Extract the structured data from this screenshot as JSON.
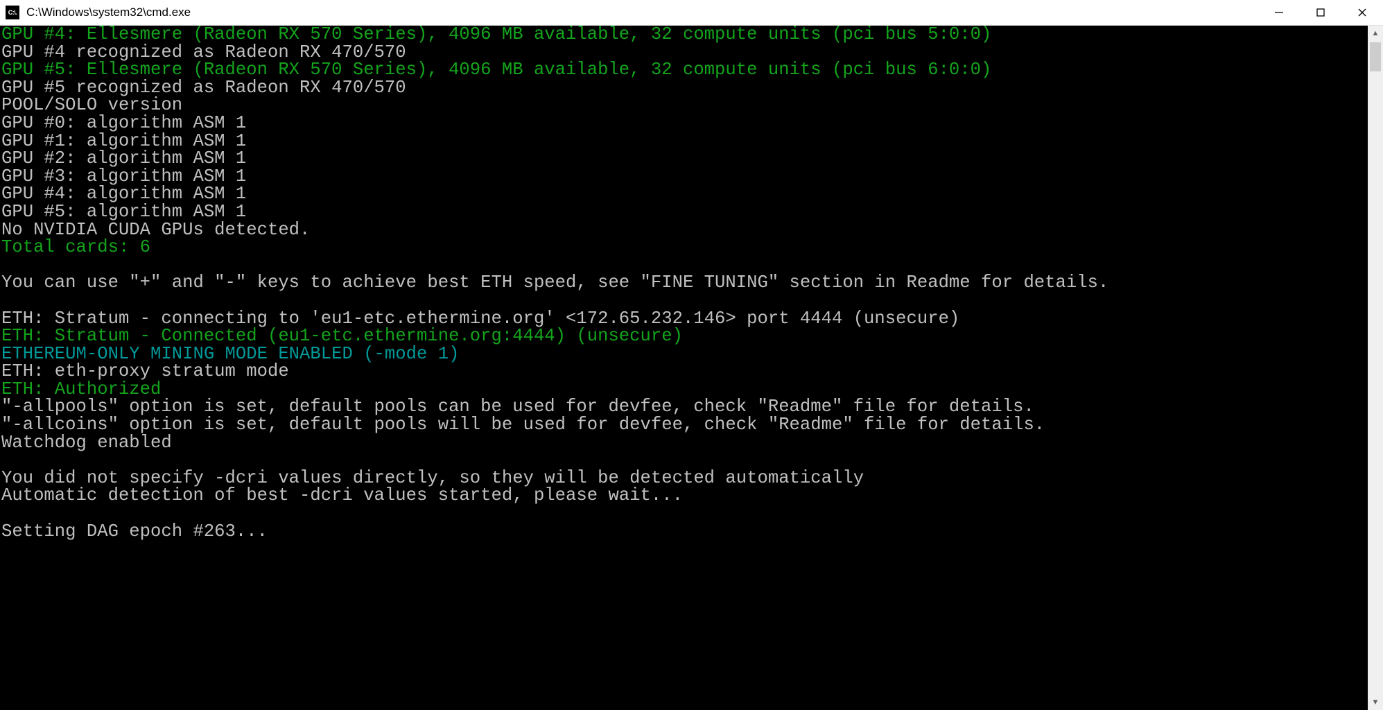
{
  "window": {
    "icon_label": "C:\\.",
    "title": "C:\\Windows\\system32\\cmd.exe"
  },
  "lines": [
    {
      "cls": "green",
      "text": "GPU #4: Ellesmere (Radeon RX 570 Series), 4096 MB available, 32 compute units (pci bus 5:0:0)"
    },
    {
      "cls": "white",
      "text": "GPU #4 recognized as Radeon RX 470/570"
    },
    {
      "cls": "green",
      "text": "GPU #5: Ellesmere (Radeon RX 570 Series), 4096 MB available, 32 compute units (pci bus 6:0:0)"
    },
    {
      "cls": "white",
      "text": "GPU #5 recognized as Radeon RX 470/570"
    },
    {
      "cls": "white",
      "text": "POOL/SOLO version"
    },
    {
      "cls": "white",
      "text": "GPU #0: algorithm ASM 1"
    },
    {
      "cls": "white",
      "text": "GPU #1: algorithm ASM 1"
    },
    {
      "cls": "white",
      "text": "GPU #2: algorithm ASM 1"
    },
    {
      "cls": "white",
      "text": "GPU #3: algorithm ASM 1"
    },
    {
      "cls": "white",
      "text": "GPU #4: algorithm ASM 1"
    },
    {
      "cls": "white",
      "text": "GPU #5: algorithm ASM 1"
    },
    {
      "cls": "white",
      "text": "No NVIDIA CUDA GPUs detected."
    },
    {
      "cls": "green",
      "text": "Total cards: 6"
    },
    {
      "cls": "white",
      "text": ""
    },
    {
      "cls": "white",
      "text": "You can use \"+\" and \"-\" keys to achieve best ETH speed, see \"FINE TUNING\" section in Readme for details."
    },
    {
      "cls": "white",
      "text": ""
    },
    {
      "cls": "white",
      "text": "ETH: Stratum - connecting to 'eu1-etc.ethermine.org' <172.65.232.146> port 4444 (unsecure)"
    },
    {
      "cls": "green",
      "text": "ETH: Stratum - Connected (eu1-etc.ethermine.org:4444) (unsecure)"
    },
    {
      "cls": "cyan",
      "text": "ETHEREUM-ONLY MINING MODE ENABLED (-mode 1)"
    },
    {
      "cls": "white",
      "text": "ETH: eth-proxy stratum mode"
    },
    {
      "cls": "green",
      "text": "ETH: Authorized"
    },
    {
      "cls": "white",
      "text": "\"-allpools\" option is set, default pools can be used for devfee, check \"Readme\" file for details."
    },
    {
      "cls": "white",
      "text": "\"-allcoins\" option is set, default pools will be used for devfee, check \"Readme\" file for details."
    },
    {
      "cls": "white",
      "text": "Watchdog enabled"
    },
    {
      "cls": "white",
      "text": ""
    },
    {
      "cls": "white",
      "text": "You did not specify -dcri values directly, so they will be detected automatically"
    },
    {
      "cls": "white",
      "text": "Automatic detection of best -dcri values started, please wait..."
    },
    {
      "cls": "white",
      "text": ""
    },
    {
      "cls": "white",
      "text": "Setting DAG epoch #263..."
    }
  ]
}
